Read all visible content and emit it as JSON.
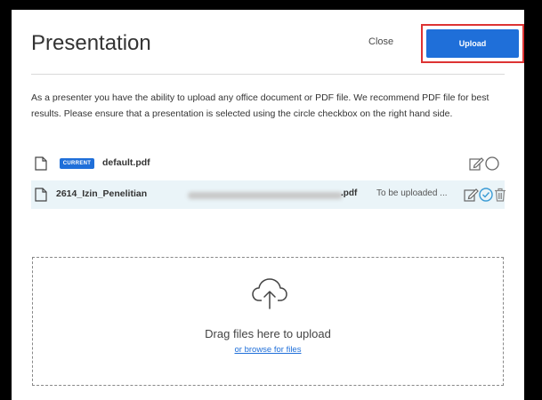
{
  "dialog": {
    "title": "Presentation",
    "close_label": "Close",
    "upload_label": "Upload",
    "description": "As a presenter you have the ability to upload any office document or PDF file. We recommend PDF file for best results. Please ensure that a presentation is selected using the circle checkbox on the right hand side."
  },
  "files": [
    {
      "badge": "CURRENT",
      "name": "default.pdf",
      "icons": [
        "document-icon",
        "edit-icon",
        "circle-checkbox-icon"
      ]
    },
    {
      "name": "2614_Izin_Penelitian",
      "extension": ".pdf",
      "status": "To be uploaded ...",
      "icons": [
        "document-icon",
        "edit-icon",
        "check-circle-icon",
        "trash-icon"
      ]
    }
  ],
  "dropzone": {
    "drag_text": "Drag files here to upload",
    "browse_text": "or browse for files",
    "icon": "cloud-upload-icon"
  },
  "colors": {
    "accent": "#1f6fd9",
    "highlight_border": "#dd3333",
    "row_highlight": "#eaf4f8",
    "check_color": "#3a9bd5"
  }
}
